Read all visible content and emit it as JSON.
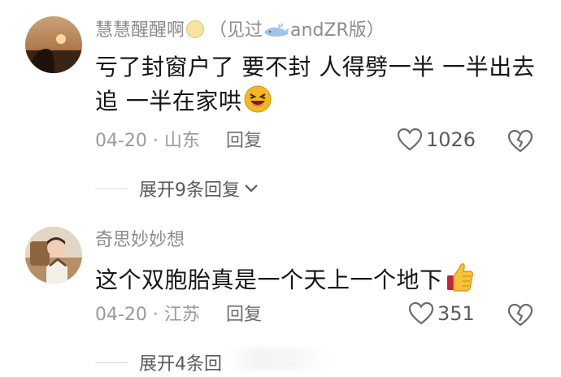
{
  "comments": [
    {
      "username": "慧慧醒醒啊",
      "suffix": "（见过",
      "suffix2": "andZR版）",
      "content": "亏了封窗户了 要不封 人得劈一半 一半出去追 一半在家哄",
      "date": "04-20",
      "location": "山东",
      "reply_label": "回复",
      "likes": "1026",
      "expand_label": "展开9条回复",
      "icons": [
        "smile-emoji-icon",
        "whale-icon",
        "laughing-emoji-icon",
        "heart-icon",
        "broken-heart-icon",
        "chevron-down-icon"
      ]
    },
    {
      "username": "奇思妙妙想",
      "content": "这个双胞胎真是一个天上一个地下",
      "date": "04-20",
      "location": "江苏",
      "reply_label": "回复",
      "likes": "351",
      "expand_label": "展开4条回",
      "icons": [
        "thumbs-up-emoji-icon",
        "heart-icon",
        "broken-heart-icon"
      ]
    }
  ],
  "colors": {
    "username": "#8c8c8c",
    "content": "#161616",
    "meta": "#9a9a9a",
    "accent_emoji": "#f5b81f"
  }
}
